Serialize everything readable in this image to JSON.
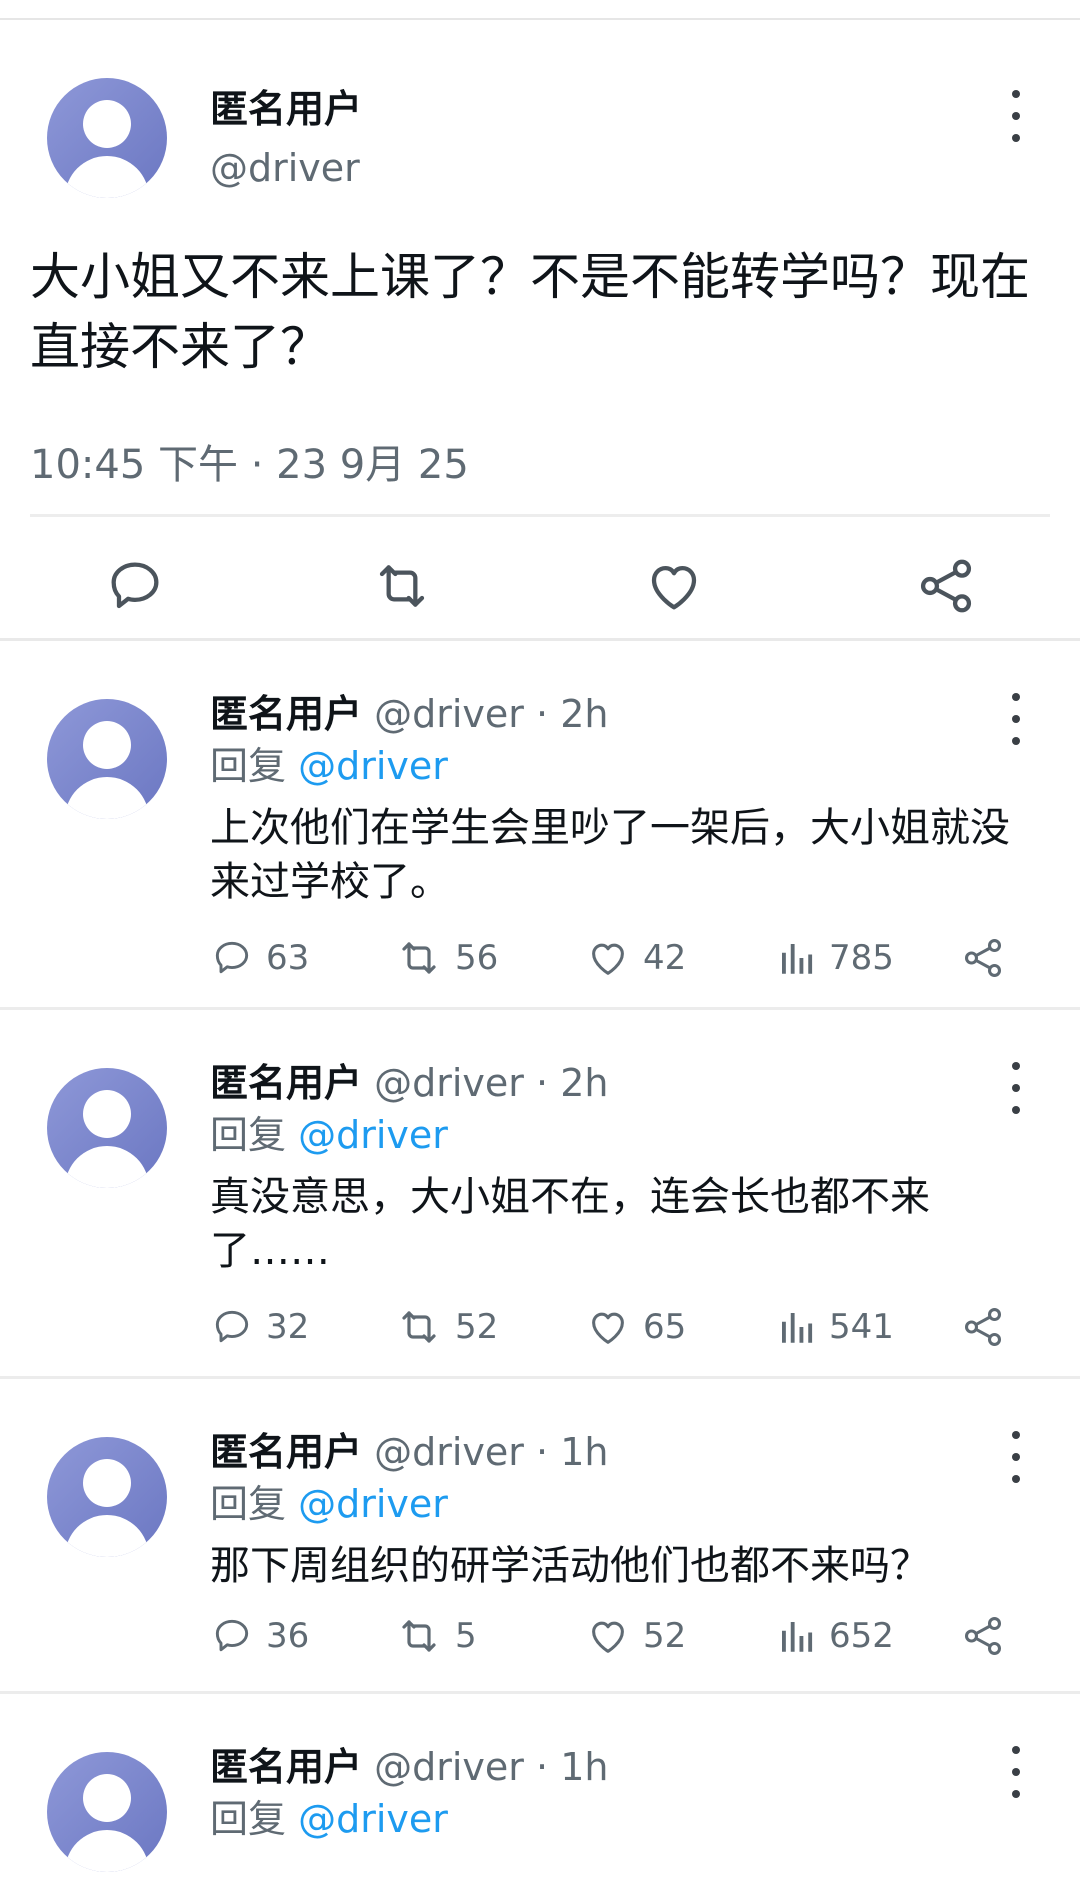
{
  "main_tweet": {
    "name": "匿名用户",
    "handle": "@driver",
    "text": "大小姐又不来上课了？不是不能转学吗？现在直接不来了？",
    "timestamp": "10:45 下午 · 23 9月 25",
    "actions": [
      "reply-icon",
      "retweet-icon",
      "like-icon",
      "share-icon"
    ]
  },
  "replies": [
    {
      "name": "匿名用户",
      "handle": "@driver",
      "dot": "·",
      "time": "2h",
      "reply_prefix": "回复",
      "reply_to": "@driver",
      "text": "上次他们在学生会里吵了一架后，大小姐就没来过学校了。",
      "stats": {
        "replies": "63",
        "retweets": "56",
        "likes": "42",
        "views": "785"
      }
    },
    {
      "name": "匿名用户",
      "handle": "@driver",
      "dot": "·",
      "time": "2h",
      "reply_prefix": "回复",
      "reply_to": "@driver",
      "text": "真没意思，大小姐不在，连会长也都不来了……",
      "stats": {
        "replies": "32",
        "retweets": "52",
        "likes": "65",
        "views": "541"
      }
    },
    {
      "name": "匿名用户",
      "handle": "@driver",
      "dot": "·",
      "time": "1h",
      "reply_prefix": "回复",
      "reply_to": "@driver",
      "text": "那下周组织的研学活动他们也都不来吗？",
      "stats": {
        "replies": "36",
        "retweets": "5",
        "likes": "52",
        "views": "652"
      }
    },
    {
      "name": "匿名用户",
      "handle": "@driver",
      "dot": "·",
      "time": "1h",
      "reply_prefix": "回复",
      "reply_to": "@driver"
    }
  ],
  "colors": {
    "link": "#1d9bf0",
    "muted": "#5f6a73",
    "avatar": "#7b86cc"
  }
}
